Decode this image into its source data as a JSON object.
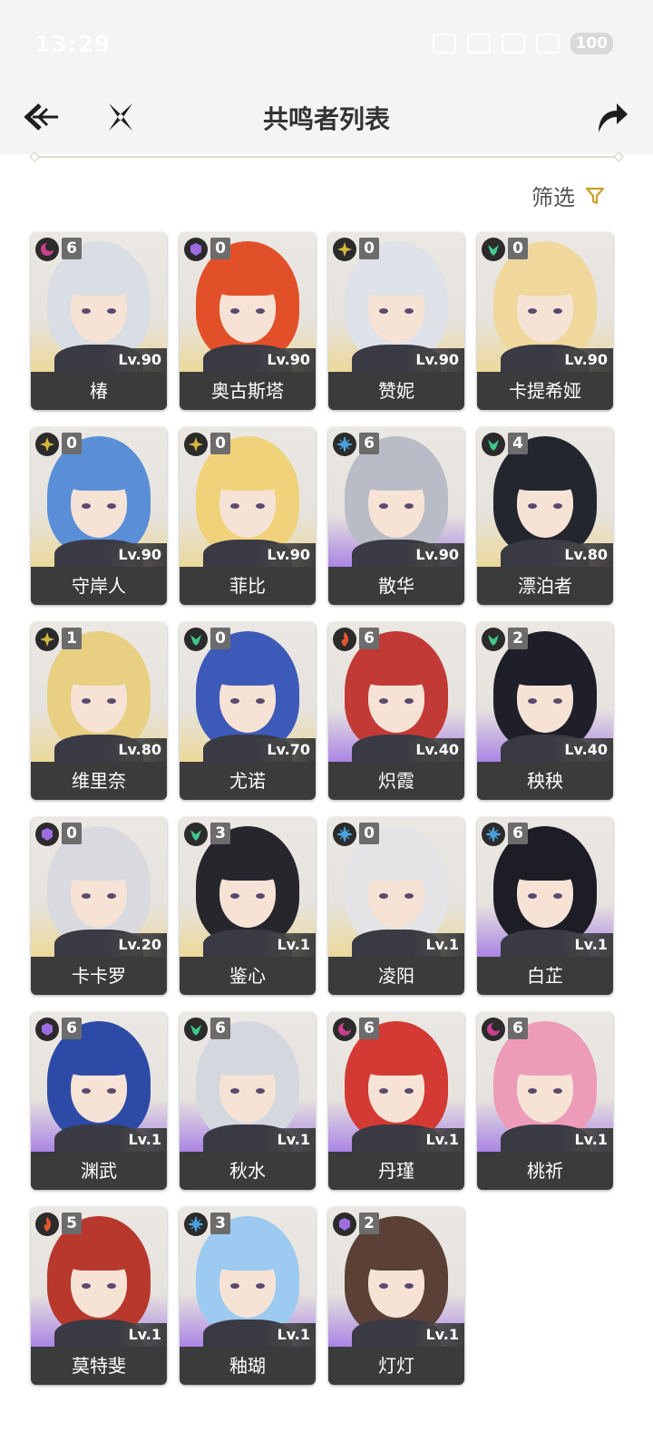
{
  "status_bar": {
    "time": "13:29",
    "battery": "100",
    "icons": [
      "alarm-icon",
      "mute-icon",
      "data-icon",
      "signal-icon",
      "signal-icon",
      "wifi-icon"
    ]
  },
  "header": {
    "title": "共鸣者列表",
    "back_icon": "back-arrow-icon",
    "close_icon": "close-x-icon",
    "share_icon": "share-arrow-icon"
  },
  "filter": {
    "label": "筛选",
    "icon": "filter-funnel-icon",
    "accent": "#c8a028"
  },
  "attribute_colors": {
    "havoc": "#c9408e",
    "spectro": "#d6b840",
    "aero": "#3fc98a",
    "glacio": "#4aa3e0",
    "fusion": "#e0562e",
    "electro": "#9d6ce0"
  },
  "resonators": [
    {
      "name": "椿",
      "level": "Lv.90",
      "chain": "6",
      "attribute": "havoc",
      "rarity": 5,
      "hair": "#d9dde4"
    },
    {
      "name": "奥古斯塔",
      "level": "Lv.90",
      "chain": "0",
      "attribute": "electro",
      "rarity": 5,
      "hair": "#e2502a"
    },
    {
      "name": "赞妮",
      "level": "Lv.90",
      "chain": "0",
      "attribute": "spectro",
      "rarity": 5,
      "hair": "#dfe2e8"
    },
    {
      "name": "卡提希娅",
      "level": "Lv.90",
      "chain": "0",
      "attribute": "aero",
      "rarity": 5,
      "hair": "#f0d79c"
    },
    {
      "name": "守岸人",
      "level": "Lv.90",
      "chain": "0",
      "attribute": "spectro",
      "rarity": 5,
      "hair": "#5a8fd8"
    },
    {
      "name": "菲比",
      "level": "Lv.90",
      "chain": "0",
      "attribute": "spectro",
      "rarity": 5,
      "hair": "#f0d27a"
    },
    {
      "name": "散华",
      "level": "Lv.90",
      "chain": "6",
      "attribute": "glacio",
      "rarity": 4,
      "hair": "#b9bcc6"
    },
    {
      "name": "漂泊者",
      "level": "Lv.80",
      "chain": "4",
      "attribute": "aero",
      "rarity": 5,
      "hair": "#23262e"
    },
    {
      "name": "维里奈",
      "level": "Lv.80",
      "chain": "1",
      "attribute": "spectro",
      "rarity": 5,
      "hair": "#e8cf82"
    },
    {
      "name": "尤诺",
      "level": "Lv.70",
      "chain": "0",
      "attribute": "aero",
      "rarity": 5,
      "hair": "#3e5ab8"
    },
    {
      "name": "炽霞",
      "level": "Lv.40",
      "chain": "6",
      "attribute": "fusion",
      "rarity": 4,
      "hair": "#c23a36"
    },
    {
      "name": "秧秧",
      "level": "Lv.40",
      "chain": "2",
      "attribute": "aero",
      "rarity": 4,
      "hair": "#1f1f2a"
    },
    {
      "name": "卡卡罗",
      "level": "Lv.20",
      "chain": "0",
      "attribute": "electro",
      "rarity": 5,
      "hair": "#d8dadf"
    },
    {
      "name": "鉴心",
      "level": "Lv.1",
      "chain": "3",
      "attribute": "aero",
      "rarity": 5,
      "hair": "#26262c"
    },
    {
      "name": "凌阳",
      "level": "Lv.1",
      "chain": "0",
      "attribute": "glacio",
      "rarity": 5,
      "hair": "#e4e4e6"
    },
    {
      "name": "白芷",
      "level": "Lv.1",
      "chain": "6",
      "attribute": "glacio",
      "rarity": 4,
      "hair": "#1d1d26"
    },
    {
      "name": "渊武",
      "level": "Lv.1",
      "chain": "6",
      "attribute": "electro",
      "rarity": 4,
      "hair": "#2d4aa6"
    },
    {
      "name": "秋水",
      "level": "Lv.1",
      "chain": "6",
      "attribute": "aero",
      "rarity": 4,
      "hair": "#d4d7de"
    },
    {
      "name": "丹瑾",
      "level": "Lv.1",
      "chain": "6",
      "attribute": "havoc",
      "rarity": 4,
      "hair": "#d33a34"
    },
    {
      "name": "桃祈",
      "level": "Lv.1",
      "chain": "6",
      "attribute": "havoc",
      "rarity": 4,
      "hair": "#ec9cb8"
    },
    {
      "name": "莫特斐",
      "level": "Lv.1",
      "chain": "5",
      "attribute": "fusion",
      "rarity": 4,
      "hair": "#b8382e"
    },
    {
      "name": "釉瑚",
      "level": "Lv.1",
      "chain": "3",
      "attribute": "glacio",
      "rarity": 4,
      "hair": "#9ccaf0"
    },
    {
      "name": "灯灯",
      "level": "Lv.1",
      "chain": "2",
      "attribute": "electro",
      "rarity": 4,
      "hair": "#5a4036"
    }
  ]
}
